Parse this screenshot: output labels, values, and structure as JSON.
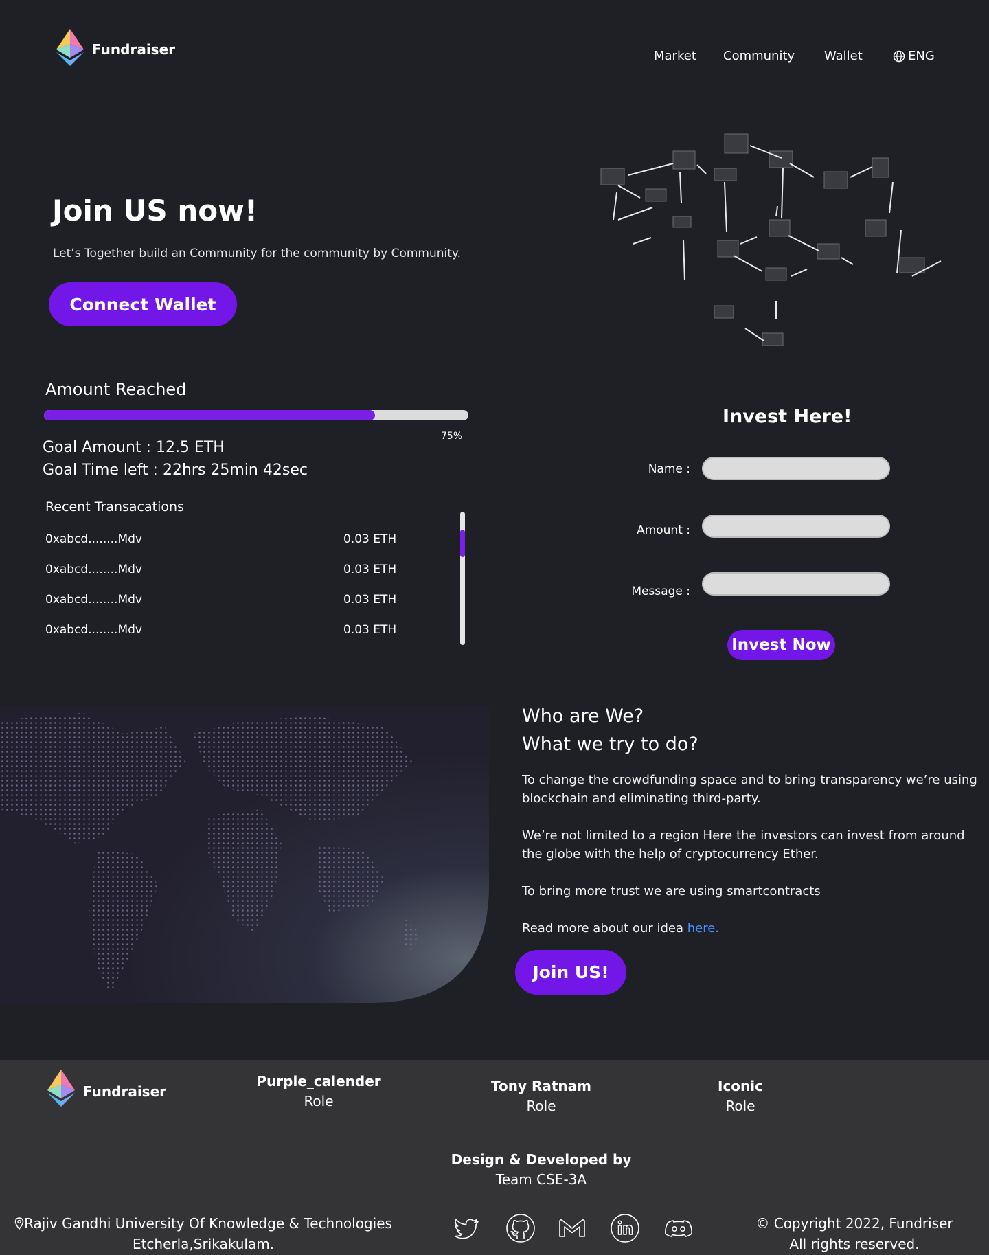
{
  "header": {
    "brand": "Fundraiser",
    "nav": [
      "Market",
      "Community",
      "Wallet"
    ],
    "lang": "ENG"
  },
  "hero": {
    "title": "Join US now!",
    "subtitle": "Let’s Together build an Community for the community by Community.",
    "connect_label": "Connect Wallet"
  },
  "progress": {
    "title": "Amount Reached",
    "percent_value": 0.78,
    "percent_label": "75%",
    "goal_amount": "Goal Amount : 12.5 ETH",
    "goal_time": "Goal Time left : 22hrs 25min 42sec"
  },
  "transactions": {
    "title": "Recent Transacations",
    "rows": [
      {
        "addr": "0xabcd........Mdv",
        "amount": "0.03 ETH"
      },
      {
        "addr": "0xabcd........Mdv",
        "amount": "0.03 ETH"
      },
      {
        "addr": "0xabcd........Mdv",
        "amount": "0.03 ETH"
      },
      {
        "addr": "0xabcd........Mdv",
        "amount": "0.03 ETH"
      }
    ]
  },
  "invest": {
    "title": "Invest Here!",
    "name_label": "Name :",
    "amount_label": "Amount :",
    "message_label": "Message :",
    "name_value": "",
    "amount_value": "",
    "message_value": "",
    "button": "Invest Now"
  },
  "about": {
    "heading1": "Who are We?",
    "heading2": "What we try to do?",
    "p1": "To change the crowdfunding space and to bring transparency we’re using blockchain and eliminating third-party.",
    "p2": "We’re not limited to a region Here the investors can invest from around the globe with the help of cryptocurrency Ether.",
    "p3": "To bring more trust we are using smartcontracts",
    "p4": "Read more about our idea ",
    "link": "here.",
    "button": "Join US!"
  },
  "footer": {
    "brand": "Fundraiser",
    "members": [
      {
        "name": "Purple_calender",
        "role": "Role"
      },
      {
        "name": "Tony Ratnam",
        "role": "Role"
      },
      {
        "name": "Iconic",
        "role": "Role"
      }
    ],
    "credit_title": "Design & Developed by",
    "credit_team": "Team CSE-3A",
    "address_line1": "Rajiv Gandhi University Of Knowledge & Technologies",
    "address_line2": "Etcherla,Srikakulam.",
    "copyright_line1": "© Copyright 2022, Fundriser",
    "copyright_line2": "All rights reserved.",
    "socials": [
      "twitter-icon",
      "github-icon",
      "gmail-icon",
      "linkedin-icon",
      "discord-icon"
    ]
  },
  "colors": {
    "background": "#1f2026",
    "accent": "#7316e8",
    "footer_bg": "#343436",
    "link": "#4a8fff"
  }
}
